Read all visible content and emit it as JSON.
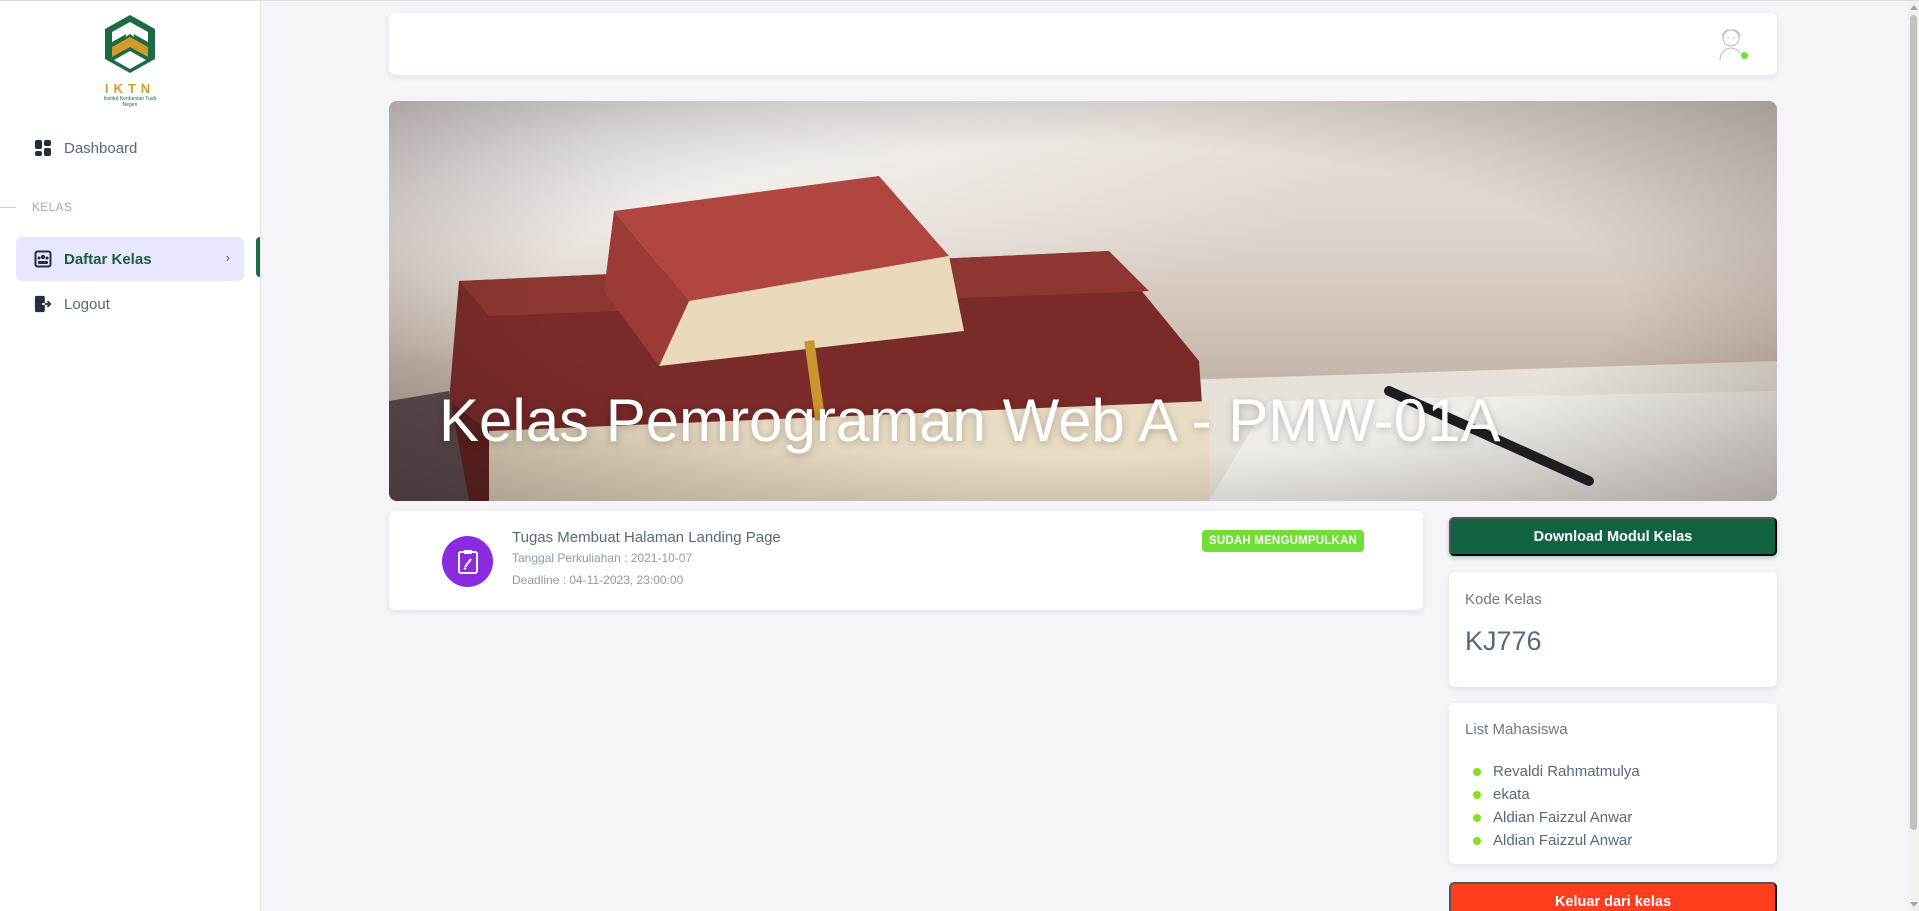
{
  "app": {
    "logo_text": "IKTN",
    "logo_subtitle": "Institut Kerdamian Tuah Negeri"
  },
  "sidebar": {
    "dashboard_label": "Dashboard",
    "section_label": "KELAS",
    "daftar_kelas_label": "Daftar Kelas",
    "logout_label": "Logout"
  },
  "banner": {
    "title": "Kelas Pemrograman Web A - PMW-01A"
  },
  "task": {
    "title": "Tugas Membuat Halaman Landing Page",
    "date": "Tanggal Perkuliahan : 2021-10-07",
    "deadline": "Deadline : 04-11-2023, 23:00:00",
    "status": "SUDAH MENGUMPULKAN"
  },
  "actions": {
    "download_label": "Download Modul Kelas",
    "leave_label": "Keluar dari kelas"
  },
  "kode_kelas": {
    "label": "Kode Kelas",
    "value": "KJ776"
  },
  "mahasiswa": {
    "label": "List Mahasiswa",
    "students": [
      "Revaldi Rahmatmulya",
      "ekata",
      "Aldian Faizzul Anwar",
      "Aldian Faizzul Anwar"
    ]
  },
  "colors": {
    "primary_green": "#116240",
    "active_bg": "#e7e7ff",
    "badge_success": "#71dd37",
    "danger": "#ff3e1d",
    "task_icon": "#8a2be2"
  }
}
